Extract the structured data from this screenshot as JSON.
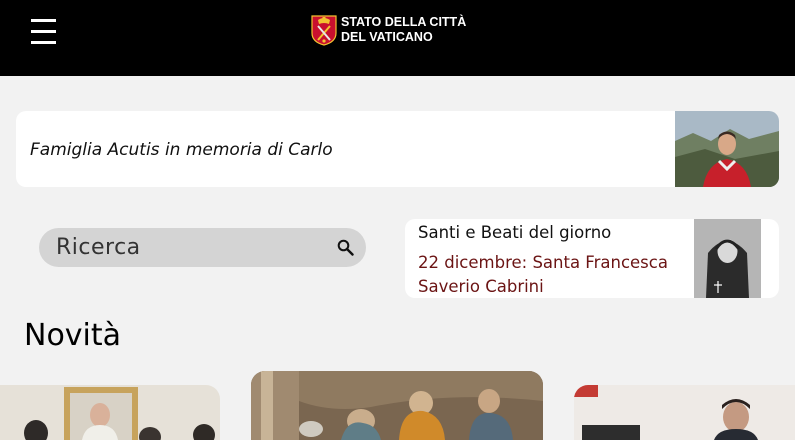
{
  "header": {
    "menu_icon": "hamburger-menu-icon",
    "logo": {
      "crest_icon": "vatican-crest-icon",
      "line1": "STATO DELLA CITTÀ",
      "line2": "DEL VATICANO"
    }
  },
  "featured_news": {
    "title": "Famiglia Acutis in memoria di Carlo"
  },
  "search": {
    "placeholder": "Ricerca",
    "icon": "search-icon"
  },
  "saints": {
    "heading": "Santi e Beati del giorno",
    "entry": "22 dicembre: Santa Francesca Saverio Cabrini"
  },
  "news_section": {
    "title": "Novità"
  },
  "colors": {
    "header_bg": "#000000",
    "page_bg": "#f2f2f2",
    "saint_accent": "#6b1414",
    "search_bg": "#d4d4d4"
  }
}
